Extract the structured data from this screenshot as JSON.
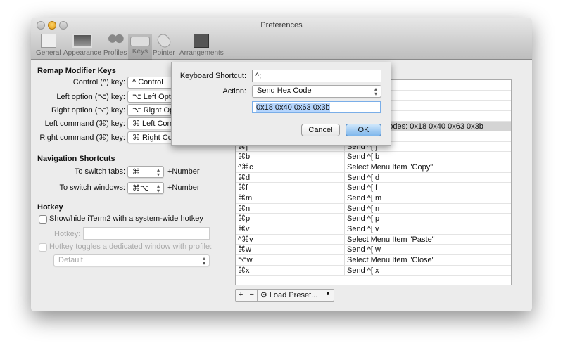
{
  "window": {
    "title": "Preferences"
  },
  "toolbar": [
    {
      "label": "General"
    },
    {
      "label": "Appearance"
    },
    {
      "label": "Profiles"
    },
    {
      "label": "Keys",
      "selected": true
    },
    {
      "label": "Pointer"
    },
    {
      "label": "Arrangements"
    }
  ],
  "remap": {
    "heading": "Remap Modifier Keys",
    "rows": [
      {
        "label": "Control (^) key:",
        "value": "^ Control"
      },
      {
        "label": "Left option (⌥) key:",
        "value": "⌥ Left Option"
      },
      {
        "label": "Right option (⌥) key:",
        "value": "⌥ Right Option"
      },
      {
        "label": "Left command (⌘) key:",
        "value": "⌘ Left Command"
      },
      {
        "label": "Right command (⌘) key:",
        "value": "⌘ Right Command"
      }
    ]
  },
  "nav": {
    "heading": "Navigation Shortcuts",
    "tabs_label": "To switch tabs:",
    "tabs_value": "⌘",
    "windows_label": "To switch windows:",
    "windows_value": "⌘⌥",
    "suffix": "+Number"
  },
  "hotkey": {
    "heading": "Hotkey",
    "show_hide": "Show/hide iTerm2 with a system-wide hotkey",
    "hotkey_label": "Hotkey:",
    "hotkey_value": "",
    "toggle": "Hotkey toggles a dedicated window with profile:",
    "profile": "Default"
  },
  "table": {
    "rows": [
      {
        "key": "⇧⌘",
        "action": ""
      },
      {
        "key": "⌘/",
        "action": ""
      },
      {
        "key": "⇧⌘",
        "action": ""
      },
      {
        "key": "⌘.",
        "action": ""
      },
      {
        "key": "^;",
        "action": "Send Hex Codes: 0x18 0x40 0x63 0x3b",
        "selected": true
      },
      {
        "key": "⌘[",
        "action": "Send ^[ ["
      },
      {
        "key": "⌘]",
        "action": "Send ^[ ]"
      },
      {
        "key": "⌘b",
        "action": "Send ^[ b"
      },
      {
        "key": "^⌘c",
        "action": "Select Menu Item \"Copy\""
      },
      {
        "key": "⌘d",
        "action": "Send ^[ d"
      },
      {
        "key": "⌘f",
        "action": "Send ^[ f"
      },
      {
        "key": "⌘m",
        "action": "Send ^[ m"
      },
      {
        "key": "⌘n",
        "action": "Send ^[ n"
      },
      {
        "key": "⌘p",
        "action": "Send ^[ p"
      },
      {
        "key": "⌘v",
        "action": "Send ^[ v"
      },
      {
        "key": "^⌘v",
        "action": "Select Menu Item \"Paste\""
      },
      {
        "key": "⌘w",
        "action": "Send ^[ w"
      },
      {
        "key": "⌥w",
        "action": "Select Menu Item \"Close\""
      },
      {
        "key": "⌘x",
        "action": "Send ^[ x"
      }
    ]
  },
  "buttons": {
    "add": "+",
    "remove": "−",
    "load_preset": "Load Preset..."
  },
  "dialog": {
    "shortcut_label": "Keyboard Shortcut:",
    "shortcut_value": "^;",
    "action_label": "Action:",
    "action_value": "Send Hex Code",
    "hex_value": "0x18 0x40 0x63 0x3b",
    "cancel": "Cancel",
    "ok": "OK"
  },
  "colors": {
    "selection": "#b5d5fd",
    "default_button": "#7fb6ec"
  }
}
